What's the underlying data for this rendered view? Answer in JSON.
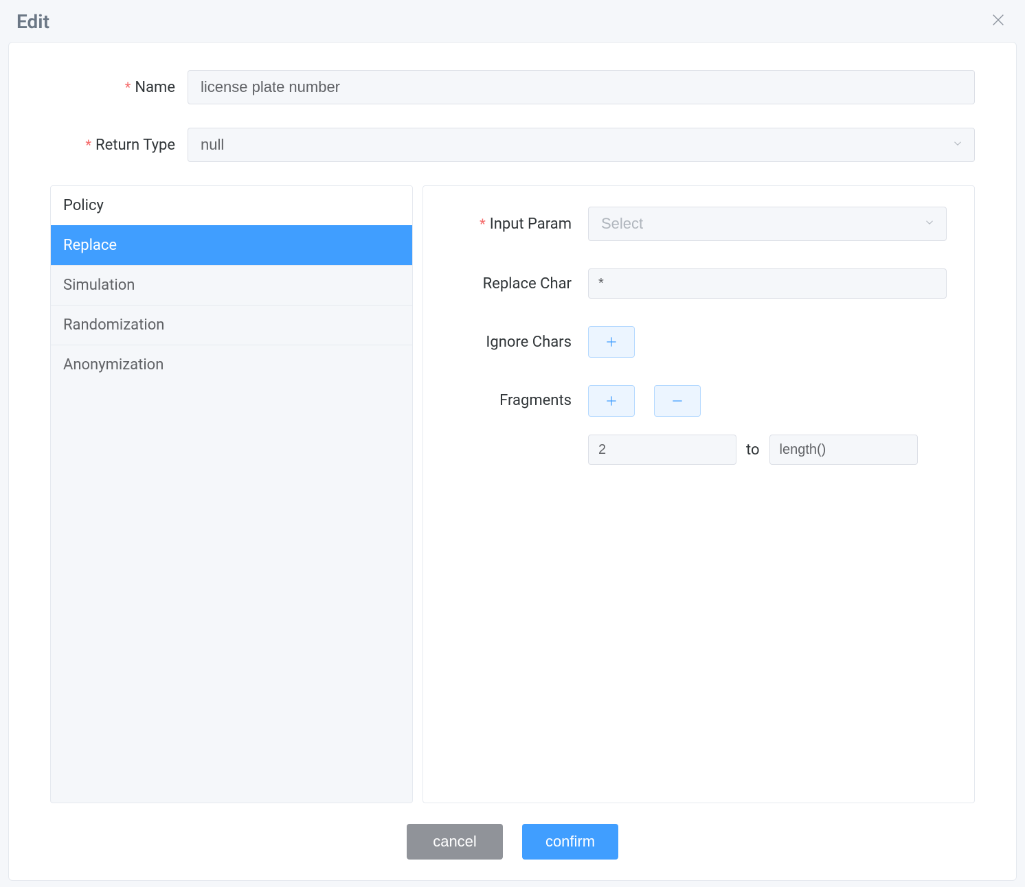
{
  "dialog": {
    "title": "Edit"
  },
  "form": {
    "name_label": "Name",
    "name_value": "license plate number",
    "return_type_label": "Return Type",
    "return_type_value": "null"
  },
  "sidebar": {
    "header": "Policy",
    "items": [
      {
        "label": "Replace",
        "active": true
      },
      {
        "label": "Simulation",
        "active": false
      },
      {
        "label": "Randomization",
        "active": false
      },
      {
        "label": "Anonymization",
        "active": false
      }
    ]
  },
  "panel": {
    "input_param_label": "Input Param",
    "input_param_placeholder": "Select",
    "replace_char_label": "Replace Char",
    "replace_char_value": "*",
    "ignore_chars_label": "Ignore Chars",
    "fragments_label": "Fragments",
    "fragment_from": "2",
    "fragment_to_label": "to",
    "fragment_to": "length()"
  },
  "footer": {
    "cancel": "cancel",
    "confirm": "confirm"
  }
}
